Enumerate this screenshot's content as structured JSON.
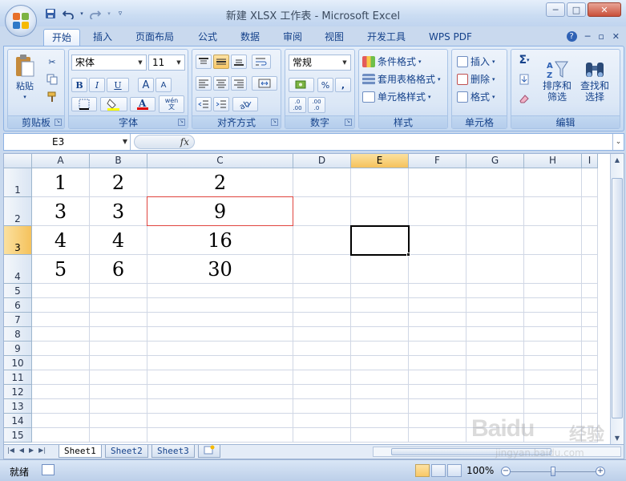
{
  "window": {
    "title": "新建 XLSX 工作表 - Microsoft Excel",
    "controls": {
      "minimize": "─",
      "maximize": "□",
      "close": "✕"
    }
  },
  "qat": {
    "save": "save-icon",
    "undo": "undo-icon",
    "redo": "redo-icon",
    "customize": "customize-icon"
  },
  "tabs": [
    {
      "label": "开始",
      "active": true
    },
    {
      "label": "插入"
    },
    {
      "label": "页面布局"
    },
    {
      "label": "公式"
    },
    {
      "label": "数据"
    },
    {
      "label": "审阅"
    },
    {
      "label": "视图"
    },
    {
      "label": "开发工具"
    },
    {
      "label": "WPS PDF"
    }
  ],
  "ribbon": {
    "clipboard": {
      "label": "剪贴板",
      "paste": "粘贴"
    },
    "font": {
      "label": "字体",
      "name": "宋体",
      "size": "11",
      "bold": "B",
      "italic": "I",
      "underline": "U",
      "grow": "A",
      "shrink": "A",
      "phonetic": "wén\n文"
    },
    "alignment": {
      "label": "对齐方式"
    },
    "number": {
      "label": "数字",
      "format": "常规",
      "percent": "%",
      "comma": ",",
      "inc_decimal": ".0\n.00",
      "dec_decimal": ".00\n.0"
    },
    "styles": {
      "label": "样式",
      "conditional": "条件格式",
      "table": "套用表格格式",
      "cell": "单元格样式"
    },
    "cells": {
      "label": "单元格",
      "insert": "插入",
      "delete": "删除",
      "format": "格式"
    },
    "editing": {
      "label": "编辑",
      "sigma": "Σ",
      "sort": "排序和\n筛选",
      "find": "查找和\n选择"
    }
  },
  "formula_bar": {
    "name_box": "E3",
    "fx": "fx",
    "content": ""
  },
  "grid": {
    "columns": [
      "A",
      "B",
      "C",
      "D",
      "E",
      "F",
      "G",
      "H",
      "I"
    ],
    "rows": [
      "1",
      "2",
      "3",
      "4",
      "5",
      "6",
      "7",
      "8",
      "9",
      "10",
      "11",
      "12",
      "13",
      "14",
      "15"
    ],
    "selected_cell": "E3",
    "highlighted_cell": "C2",
    "cells": {
      "A1": "1",
      "B1": "2",
      "C1": "2",
      "A2": "3",
      "B2": "3",
      "C2": "9",
      "A3": "4",
      "B3": "4",
      "C3": "16",
      "A4": "5",
      "B4": "6",
      "C4": "30"
    }
  },
  "sheets": [
    "Sheet1",
    "Sheet2",
    "Sheet3"
  ],
  "active_sheet": "Sheet1",
  "status": {
    "ready": "就绪",
    "zoom": "100%"
  },
  "watermark": {
    "brand": "Baidu",
    "cn": "经验",
    "url": "jingyan.baidu.com"
  },
  "colors": {
    "accent": "#15428b",
    "selection_header": "#f5c25c",
    "highlight_border": "#e0443e"
  }
}
